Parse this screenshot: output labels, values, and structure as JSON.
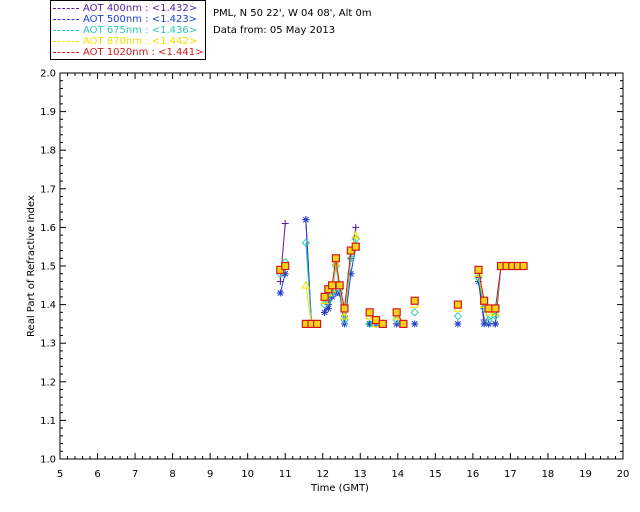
{
  "header": {
    "site": "PML, N 50 22', W 04 08', Alt 0m",
    "date": "Data from: 05 May 2013"
  },
  "chart_data": {
    "type": "line",
    "xlabel": "Time (GMT)",
    "ylabel": "Real Part of Refractive Index",
    "xlim": [
      5,
      20
    ],
    "ylim": [
      1.0,
      2.0
    ],
    "xticks": [
      "5",
      "6",
      "7",
      "8",
      "9",
      "10",
      "11",
      "12",
      "13",
      "14",
      "15",
      "16",
      "17",
      "18",
      "19",
      "20"
    ],
    "yticks": [
      "1.0",
      "1.1",
      "1.2",
      "1.3",
      "1.4",
      "1.5",
      "1.6",
      "1.7",
      "1.8",
      "1.9",
      "2.0"
    ],
    "grid": false,
    "legend_position": "top-left",
    "series": [
      {
        "name": "AOT  400nm : <1.432>",
        "color": "#5a1f9e",
        "marker": "plus",
        "segments": [
          [
            [
              10.87,
              1.46
            ],
            [
              11.0,
              1.61
            ]
          ],
          [
            [
              11.55,
              1.62
            ],
            [
              11.7,
              1.35
            ],
            [
              11.85,
              1.35
            ]
          ],
          [
            [
              12.05,
              1.38
            ],
            [
              12.15,
              1.4
            ],
            [
              12.25,
              1.43
            ],
            [
              12.35,
              1.43
            ],
            [
              12.45,
              1.43
            ],
            [
              12.58,
              1.37
            ],
            [
              12.75,
              1.52
            ],
            [
              12.88,
              1.6
            ]
          ],
          [
            [
              13.25,
              1.35
            ],
            [
              13.42,
              1.35
            ],
            [
              13.6,
              1.35
            ]
          ],
          [
            [
              13.97,
              1.35
            ],
            [
              14.15,
              1.35
            ]
          ],
          [
            [
              16.15,
              1.47
            ],
            [
              16.3,
              1.36
            ],
            [
              16.42,
              1.35
            ],
            [
              16.6,
              1.35
            ],
            [
              16.75,
              1.5
            ],
            [
              16.9,
              1.5
            ],
            [
              17.05,
              1.5
            ],
            [
              17.2,
              1.5
            ],
            [
              17.35,
              1.5
            ]
          ]
        ]
      },
      {
        "name": "AOT  500nm : <1.423>",
        "color": "#1f3fc8",
        "marker": "asterisk",
        "segments": [
          [
            [
              10.87,
              1.43
            ],
            [
              11.0,
              1.48
            ]
          ],
          [
            [
              11.55,
              1.62
            ],
            [
              11.7,
              1.35
            ],
            [
              11.85,
              1.35
            ]
          ],
          [
            [
              12.05,
              1.38
            ],
            [
              12.15,
              1.39
            ],
            [
              12.25,
              1.42
            ],
            [
              12.35,
              1.43
            ],
            [
              12.45,
              1.43
            ],
            [
              12.58,
              1.35
            ],
            [
              12.75,
              1.48
            ],
            [
              12.88,
              1.55
            ]
          ],
          [
            [
              13.25,
              1.35
            ],
            [
              13.42,
              1.35
            ],
            [
              13.6,
              1.35
            ]
          ],
          [
            [
              13.97,
              1.35
            ],
            [
              14.15,
              1.35
            ]
          ],
          [
            [
              14.45,
              1.35
            ]
          ],
          [
            [
              15.6,
              1.35
            ]
          ],
          [
            [
              16.15,
              1.46
            ],
            [
              16.3,
              1.35
            ],
            [
              16.42,
              1.35
            ],
            [
              16.6,
              1.35
            ],
            [
              16.75,
              1.5
            ],
            [
              16.9,
              1.5
            ],
            [
              17.05,
              1.5
            ],
            [
              17.2,
              1.5
            ],
            [
              17.35,
              1.5
            ]
          ]
        ]
      },
      {
        "name": "AOT  675nm : <1.436>",
        "color": "#2fc9b0",
        "marker": "diamond",
        "segments": [
          [
            [
              10.87,
              1.48
            ],
            [
              11.0,
              1.51
            ]
          ],
          [
            [
              11.55,
              1.56
            ],
            [
              11.7,
              1.35
            ],
            [
              11.85,
              1.35
            ]
          ],
          [
            [
              12.05,
              1.4
            ],
            [
              12.15,
              1.41
            ],
            [
              12.25,
              1.43
            ],
            [
              12.35,
              1.5
            ],
            [
              12.45,
              1.44
            ],
            [
              12.58,
              1.36
            ],
            [
              12.75,
              1.52
            ],
            [
              12.88,
              1.57
            ]
          ],
          [
            [
              13.25,
              1.35
            ],
            [
              13.42,
              1.35
            ],
            [
              13.6,
              1.35
            ]
          ],
          [
            [
              13.97,
              1.36
            ],
            [
              14.15,
              1.35
            ]
          ],
          [
            [
              14.45,
              1.38
            ]
          ],
          [
            [
              15.6,
              1.37
            ]
          ],
          [
            [
              16.15,
              1.47
            ],
            [
              16.3,
              1.39
            ],
            [
              16.42,
              1.36
            ],
            [
              16.6,
              1.37
            ],
            [
              16.75,
              1.5
            ],
            [
              16.9,
              1.5
            ],
            [
              17.05,
              1.5
            ],
            [
              17.2,
              1.5
            ],
            [
              17.35,
              1.5
            ]
          ]
        ]
      },
      {
        "name": "AOT  870nm : <1.442>",
        "color": "#f5dd00",
        "marker": "triangle",
        "segments": [
          [
            [
              10.87,
              1.49
            ],
            [
              11.0,
              1.5
            ]
          ],
          [
            [
              11.55,
              1.45
            ],
            [
              11.7,
              1.35
            ],
            [
              11.85,
              1.35
            ]
          ],
          [
            [
              12.05,
              1.41
            ],
            [
              12.15,
              1.43
            ],
            [
              12.25,
              1.44
            ],
            [
              12.35,
              1.51
            ],
            [
              12.45,
              1.45
            ],
            [
              12.58,
              1.37
            ],
            [
              12.75,
              1.54
            ],
            [
              12.88,
              1.58
            ]
          ],
          [
            [
              13.25,
              1.37
            ],
            [
              13.42,
              1.35
            ],
            [
              13.6,
              1.35
            ]
          ],
          [
            [
              13.97,
              1.37
            ],
            [
              14.15,
              1.35
            ]
          ],
          [
            [
              14.45,
              1.4
            ]
          ],
          [
            [
              15.6,
              1.39
            ]
          ],
          [
            [
              16.15,
              1.48
            ],
            [
              16.3,
              1.4
            ],
            [
              16.42,
              1.38
            ],
            [
              16.6,
              1.38
            ],
            [
              16.75,
              1.5
            ],
            [
              16.9,
              1.5
            ],
            [
              17.05,
              1.5
            ],
            [
              17.2,
              1.5
            ],
            [
              17.35,
              1.5
            ]
          ]
        ]
      },
      {
        "name": "AOT 1020nm : <1.441>",
        "color": "#d11a1a",
        "marker": "square",
        "segments": [
          [
            [
              10.87,
              1.49
            ],
            [
              11.0,
              1.5
            ]
          ],
          [
            [
              11.55,
              1.35
            ],
            [
              11.7,
              1.35
            ],
            [
              11.85,
              1.35
            ]
          ],
          [
            [
              12.05,
              1.42
            ],
            [
              12.15,
              1.44
            ],
            [
              12.25,
              1.45
            ],
            [
              12.35,
              1.52
            ],
            [
              12.45,
              1.45
            ],
            [
              12.58,
              1.39
            ],
            [
              12.75,
              1.54
            ],
            [
              12.88,
              1.55
            ]
          ],
          [
            [
              13.25,
              1.38
            ],
            [
              13.42,
              1.36
            ],
            [
              13.6,
              1.35
            ]
          ],
          [
            [
              13.97,
              1.38
            ],
            [
              14.15,
              1.35
            ]
          ],
          [
            [
              14.45,
              1.41
            ]
          ],
          [
            [
              15.6,
              1.4
            ]
          ],
          [
            [
              16.15,
              1.49
            ],
            [
              16.3,
              1.41
            ],
            [
              16.42,
              1.39
            ],
            [
              16.6,
              1.39
            ],
            [
              16.75,
              1.5
            ],
            [
              16.9,
              1.5
            ],
            [
              17.05,
              1.5
            ],
            [
              17.2,
              1.5
            ],
            [
              17.35,
              1.5
            ]
          ]
        ]
      }
    ]
  }
}
